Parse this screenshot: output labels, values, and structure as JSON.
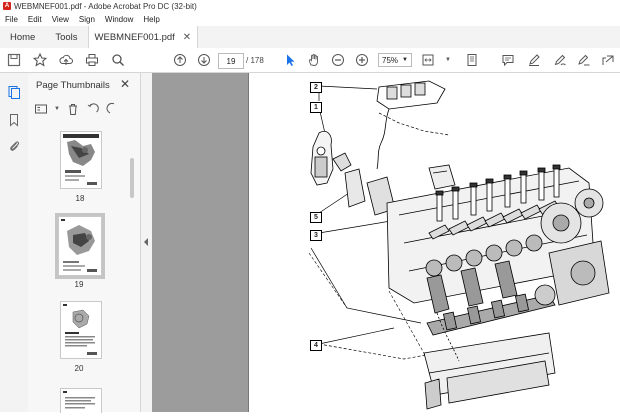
{
  "window": {
    "title": "WEBMNEF001.pdf - Adobe Acrobat Pro DC (32-bit)"
  },
  "menu": [
    "File",
    "Edit",
    "View",
    "Sign",
    "Window",
    "Help"
  ],
  "tabs": {
    "home": "Home",
    "tools": "Tools",
    "document": "WEBMNEF001.pdf"
  },
  "toolbar": {
    "current_page": "19",
    "total_pages": "/ 178",
    "zoom": "75%"
  },
  "panel": {
    "title": "Page Thumbnails"
  },
  "thumbnails": [
    {
      "label": "18"
    },
    {
      "label": "19"
    },
    {
      "label": "20"
    }
  ],
  "diagram": {
    "callouts": [
      "2",
      "1",
      "5",
      "3",
      "4"
    ]
  }
}
